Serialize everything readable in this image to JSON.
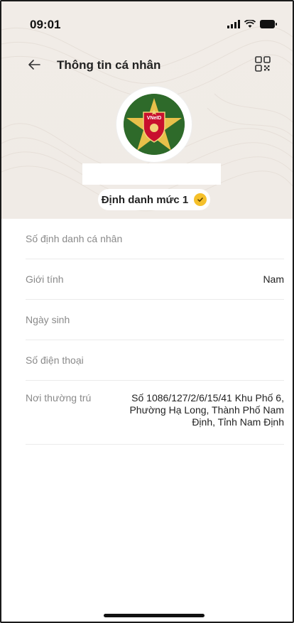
{
  "status_bar": {
    "time": "09:01"
  },
  "nav": {
    "title": "Thông tin cá nhân",
    "back_icon": "arrow-left-icon",
    "qr_icon": "qr-code-icon"
  },
  "profile": {
    "logo_text": "VNeID",
    "level_label": "Định danh mức 1"
  },
  "fields": [
    {
      "label": "Số định danh cá nhân",
      "value": ""
    },
    {
      "label": "Giới tính",
      "value": "Nam"
    },
    {
      "label": "Ngày sinh",
      "value": ""
    },
    {
      "label": "Số điện thoại",
      "value": ""
    },
    {
      "label": "Nơi thường trú",
      "value": "Số 1086/127/2/6/15/41 Khu Phố 6, Phường Hạ Long, Thành Phố Nam Định, Tỉnh Nam Định"
    }
  ],
  "colors": {
    "header_bg": "#f1ece7",
    "badge": "#f5c02a",
    "emblem_green": "#2e6a2a",
    "emblem_red": "#c8102e"
  }
}
